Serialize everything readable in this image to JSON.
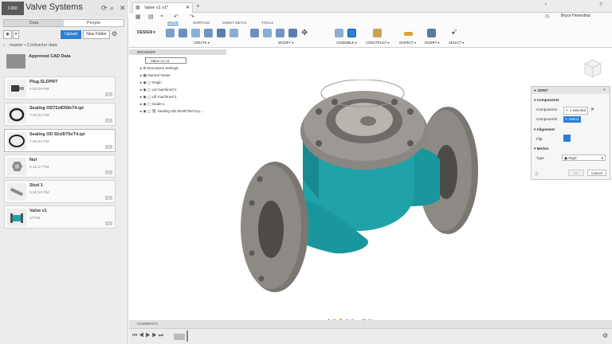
{
  "data_panel": {
    "project_title": "Valve Systems",
    "tabs": [
      "Data",
      "People"
    ],
    "upload_label": "Upload",
    "new_folder_label": "New Folder",
    "breadcrumb": "master • Contractor data",
    "items": [
      {
        "title": "Approved CAD Data",
        "date": "",
        "version": ""
      },
      {
        "title": "Plug.SLDPRT",
        "date": "4:03:08 PM",
        "version": "V1"
      },
      {
        "title": "Sealing OD72xID58xT4.ipt",
        "date": "7:40:53 PM",
        "version": "V1"
      },
      {
        "title": "Sealing OD 92xID76xT4.ipt",
        "date": "7:40:53 PM",
        "version": "V1"
      },
      {
        "title": "Nut",
        "date": "5:16:27 PM",
        "version": "V2"
      },
      {
        "title": "Stud 1",
        "date": "5:16:20 PM",
        "version": "V1"
      },
      {
        "title": "Valve v1",
        "date": "1/7/16",
        "version": "V1"
      }
    ]
  },
  "document": {
    "tab_title": "Valve v1 v1*",
    "user_name": "Bryce Heventhal"
  },
  "ribbon": {
    "workspace": "DESIGN",
    "tabs": [
      "SOLID",
      "SURFACE",
      "SHEET METAL",
      "TOOLS"
    ],
    "groups": [
      "CREATE",
      "MODIFY",
      "ASSEMBLE",
      "CONSTRUCT",
      "INSPECT",
      "INSERT",
      "SELECT"
    ]
  },
  "browser": {
    "header": "BROWSER",
    "root": "Valve v1 v1",
    "rows": [
      "Document Settings",
      "Named Views",
      "Origin",
      "Lid machined:1",
      "Lift machined:1",
      "Guide:1",
      "Sealing OD 92xID76xT4:p..."
    ]
  },
  "joint_panel": {
    "title": "JOINT",
    "section_components": "Components",
    "component1_label": "Component1",
    "component1_value": "1 selected",
    "component2_label": "Component2",
    "component2_value": "Select",
    "section_alignment": "Alignment",
    "flip_label": "Flip",
    "section_motion": "Motion",
    "type_label": "Type",
    "type_value": "Rigid",
    "ok_label": "OK",
    "cancel_label": "Cancel"
  },
  "comments_label": "COMMENTS",
  "colors": {
    "accent": "#2b7fd4",
    "teal": "#1fa3a8",
    "metal": "#6e6a65"
  }
}
